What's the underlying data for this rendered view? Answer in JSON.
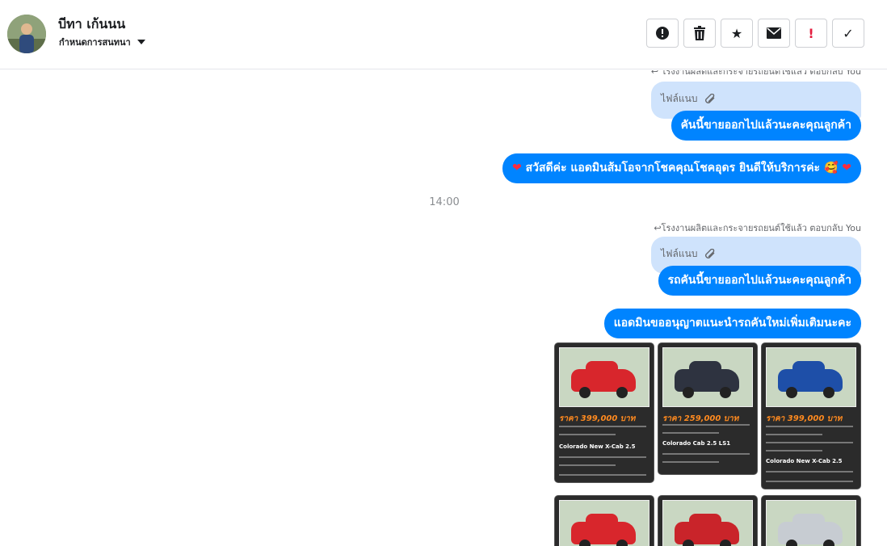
{
  "header": {
    "contact_name": "บีทา เก้นนน",
    "conversation_label": "กำหนดการสนทนา"
  },
  "toolbar": {
    "spam_icon": "!",
    "delete_icon": "🗑",
    "star_icon": "★",
    "mail_icon": "✉",
    "important_icon": "!",
    "done_icon": "✓"
  },
  "messages": {
    "reply_note_1": "↩ โรงงานผลิตและกระจายรถยนต์ใช้แล้ว ตอบกลับ You",
    "attach_1": "ไฟล์แนบ",
    "msg_1": "คันนี้ขายออกไปแล้วนะคะคุณลูกค้า",
    "msg_2_text": "สวัสดีค่ะ แอดมินส้มโอจากโชคคุณโชคอุดร ยินดีให้บริการค่ะ 🥰",
    "heart": "❤",
    "time": "14:00",
    "reply_note_2": "↩โรงงานผลิตและกระจายรถยนต์ใช้แล้ว ตอบกลับ You",
    "attach_2": "ไฟล์แนบ",
    "msg_3": "รถคันนี้ขายออกไปแล้วนะคะคุณลูกค้า",
    "msg_4": "แอดมินขออนุญาตแนะนำรถคันใหม่เพิ่มเติมนะคะ"
  },
  "cards": [
    {
      "price": "ราคา 399,000 บาท",
      "model": "Colorado New X-Cab 2.5",
      "color": "#d8262c"
    },
    {
      "price": "ราคา 259,000 บาท",
      "model": "Colorado Cab 2.5 LS1",
      "color": "#2e3340"
    },
    {
      "price": "ราคา 399,000 บาท",
      "model": "Colorado New X-Cab 2.5",
      "color": "#1e4fa8"
    },
    {
      "price": "",
      "model": "",
      "color": "#d8262c"
    },
    {
      "price": "",
      "model": "",
      "color": "#c9242a"
    },
    {
      "price": "",
      "model": "",
      "color": "#c7ccd2"
    }
  ]
}
